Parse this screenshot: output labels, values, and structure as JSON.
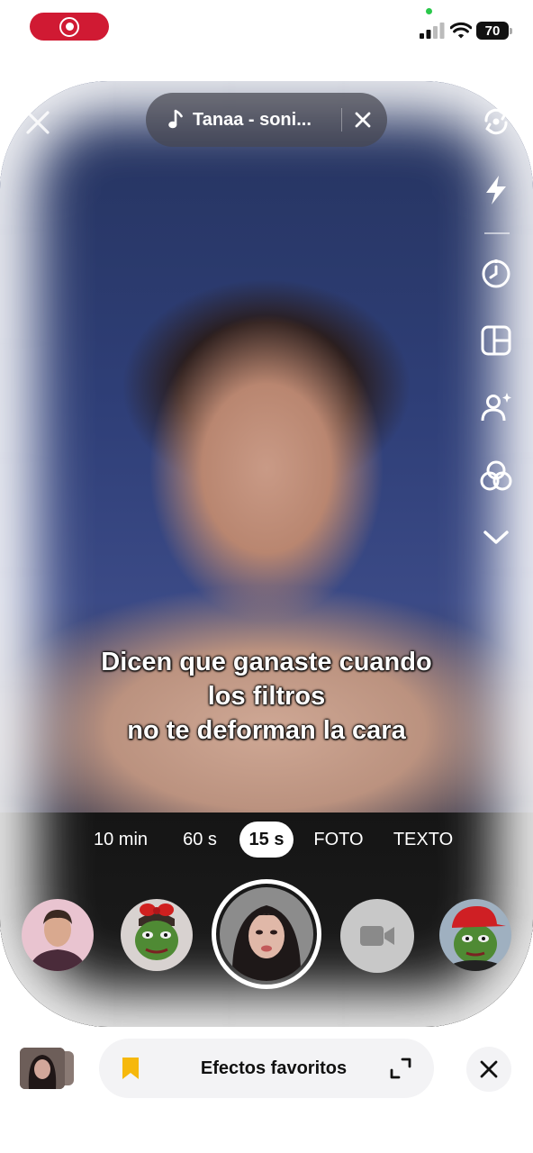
{
  "status_bar": {
    "battery_level": "70",
    "icons": [
      "screen-record-icon",
      "camera-in-use-dot",
      "cellular-signal-icon",
      "wifi-icon",
      "battery-icon"
    ]
  },
  "top": {
    "sound_title": "Tanaa - soni...",
    "icons": [
      "close-icon",
      "music-note-icon",
      "close-icon"
    ]
  },
  "toolbar": {
    "icons": [
      "flip-camera-icon",
      "flash-icon",
      "timer-icon",
      "layout-icon",
      "beauty-icon",
      "filters-icon",
      "chevron-down-icon"
    ]
  },
  "caption": {
    "line1": "Dicen que ganaste cuando",
    "line2": "los filtros",
    "line3": "no te deforman la cara"
  },
  "modes": {
    "items": [
      "10 min",
      "60 s",
      "15 s",
      "FOTO",
      "TEXTO"
    ],
    "active": "15 s"
  },
  "effects": {
    "icons": [
      "effect-man-portrait",
      "effect-frog-bow",
      "effect-selected-portrait",
      "video-camera-icon",
      "effect-frog-red-cap"
    ]
  },
  "bottom_bar": {
    "favorites_label": "Efectos favoritos",
    "icons": [
      "bookmark-icon",
      "expand-icon",
      "close-icon"
    ],
    "accent_color": "#f6b80c"
  },
  "colors": {
    "record_red": "#d01a33",
    "pill_bg": "rgba(70,70,80,0.72)",
    "active_mode_bg": "#ffffff"
  }
}
